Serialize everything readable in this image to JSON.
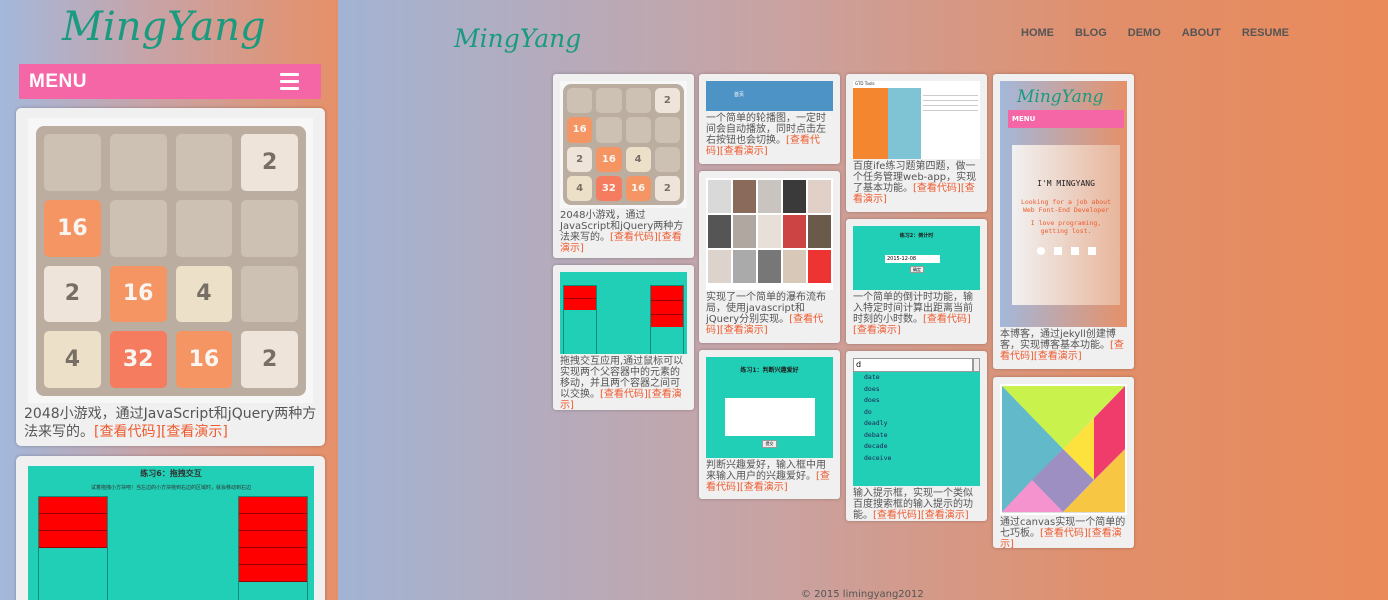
{
  "brand": {
    "logo_text": "MingYang",
    "logo_color": "#1a9a7f",
    "menu_color": "#f566a6",
    "link_color": "#ee5a2e"
  },
  "nav": {
    "items": [
      "HOME",
      "BLOG",
      "DEMO",
      "ABOUT",
      "RESUME"
    ]
  },
  "mobile": {
    "menu_label": "MENU",
    "card1": {
      "desc": "2048小游戏，通过JavaScript和jQuery两种方法来写的。",
      "code_link": "[查看代码]",
      "demo_link": "[查看演示]"
    },
    "card2": {
      "title": "练习6：拖拽交互",
      "subtitle": "试着拖拽小方块吧！当左边的小方块拖到右边的区域时，就会移动到右边"
    }
  },
  "board": {
    "tiles": [
      0,
      0,
      0,
      2,
      16,
      0,
      0,
      0,
      2,
      16,
      4,
      0,
      4,
      32,
      16,
      2
    ]
  },
  "cards": {
    "game2048": {
      "desc": "2048小游戏，通过JavaScript和jQuery两种方法来写的。",
      "code": "[查看代码]",
      "demo": "[查看演示]"
    },
    "drag": {
      "desc": "拖拽交互应用,通过鼠标可以实现两个父容器中的元素的移动，并且两个容器之间可以交换。",
      "code": "[查看代码]",
      "demo": "[查看演示]"
    },
    "carousel": {
      "thumb_text": "首页",
      "desc": "一个简单的轮播图，一定时间会自动播放，同时点击左右按钮也会切换。",
      "code": "[查看代码]",
      "demo": "[查看演示]"
    },
    "waterfall": {
      "desc": "实现了一个简单的瀑布流布局，使用javascript和jQuery分别实现。",
      "code": "[查看代码]",
      "demo": "[查看演示]"
    },
    "hobby": {
      "thumb_title": "练习1：判断兴趣爱好",
      "thumb_button": "提交",
      "desc": "判断兴趣爱好，输入框中用来输入用户的兴趣爱好。",
      "code": "[查看代码]",
      "demo": "[查看演示]"
    },
    "todo": {
      "thumb_title": "GTD Tools",
      "desc": "百度ife练习题第四题，做一个任务管理web-app，实现了基本功能。",
      "code": "[查看代码]",
      "demo": "[查看演示]"
    },
    "countdown": {
      "thumb_title": "练习2：倒计时",
      "thumb_date": "2015-12-08",
      "thumb_button": "确定",
      "desc": "一个简单的倒计时功能，输入特定时间计算出距离当前时刻的小时数。",
      "code": "[查看代码]",
      "demo": "[查看演示]"
    },
    "suggest": {
      "thumb_input": "d",
      "thumb_words": [
        "date",
        "does",
        "does",
        "do",
        "deadly",
        "debate",
        "decade",
        "deceive"
      ],
      "desc": "输入提示框，实现一个类似百度搜索框的输入提示的功能。",
      "code": "[查看代码]",
      "demo": "[查看演示]"
    },
    "blog": {
      "thumb_logo": "MingYang",
      "thumb_menu": "MENU",
      "thumb_name": "I'M MINGYANG",
      "thumb_line1": "Looking for a job about Web Font-End Developer",
      "thumb_line2": "I love programing, getting lost.",
      "desc": "本博客，通过jekyll创建博客，实现博客基本功能。",
      "code": "[查看代码]",
      "demo": "[查看演示]"
    },
    "tangram": {
      "desc": "通过canvas实现一个简单的七巧板。",
      "code": "[查看代码]",
      "demo": "[查看演示]"
    }
  },
  "footer": {
    "text": "© 2015  limingyang2012"
  }
}
